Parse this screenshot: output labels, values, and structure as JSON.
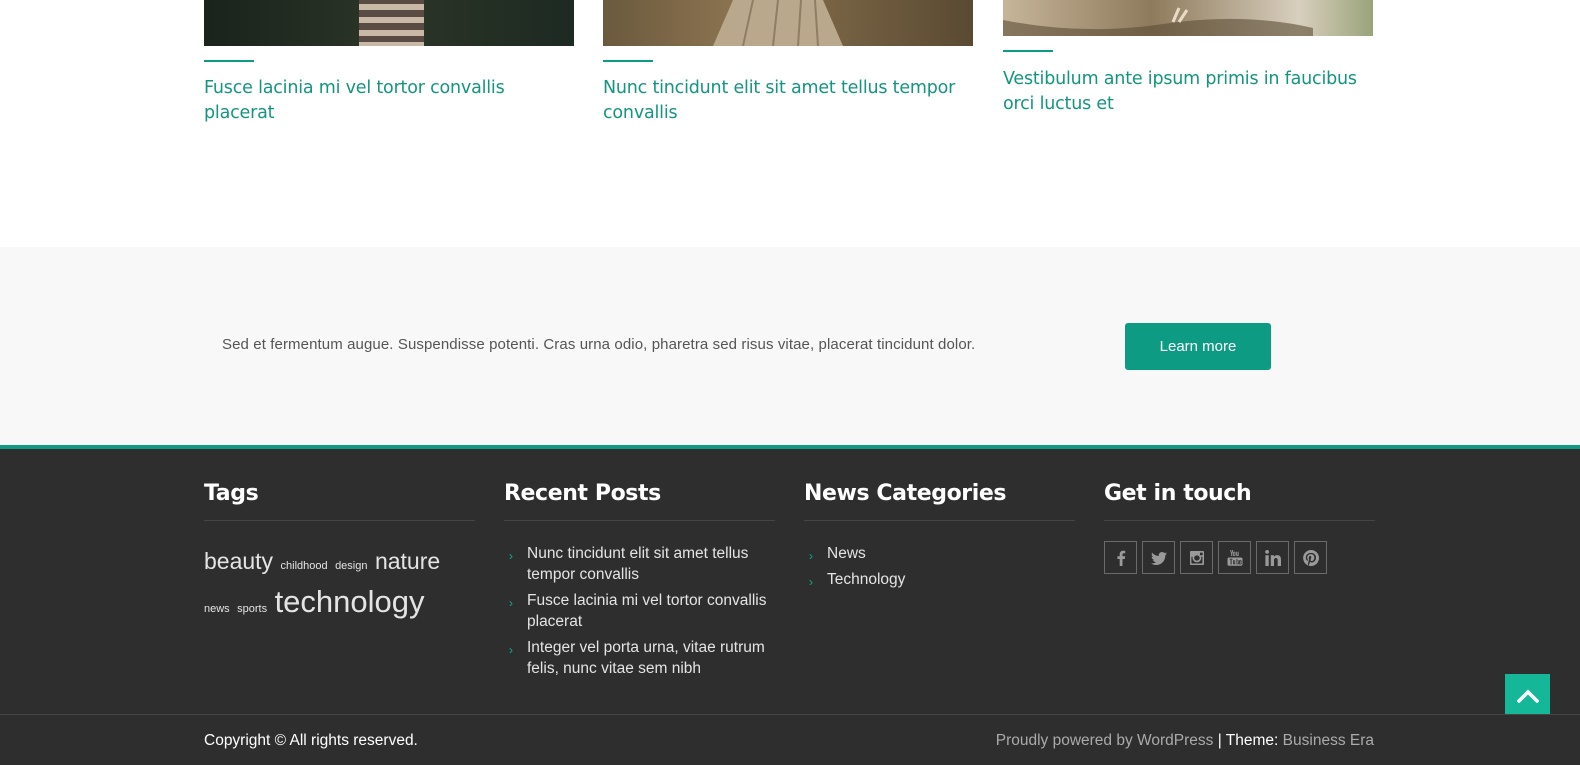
{
  "posts": [
    {
      "title": "Fusce lacinia mi vel tortor convallis placerat"
    },
    {
      "title": "Nunc tincidunt elit sit amet tellus tempor convallis"
    },
    {
      "title": "Vestibulum ante ipsum primis in faucibus orci luctus et"
    }
  ],
  "cta": {
    "text": "Sed et fermentum augue. Suspendisse potenti. Cras urna odio, pharetra sed risus vitae, placerat tincidunt dolor.",
    "button": "Learn more"
  },
  "footer": {
    "tags": {
      "title": "Tags",
      "items": [
        "beauty",
        "childhood",
        "design",
        "nature",
        "news",
        "sports",
        "technology"
      ]
    },
    "recent_posts": {
      "title": "Recent Posts",
      "items": [
        "Nunc tincidunt elit sit amet tellus tempor convallis",
        "Fusce lacinia mi vel tortor convallis placerat",
        "Integer vel porta urna, vitae rutrum felis, nunc vitae sem nibh"
      ]
    },
    "categories": {
      "title": "News Categories",
      "items": [
        "News",
        "Technology"
      ]
    },
    "contact": {
      "title": "Get in touch",
      "socials": [
        "facebook-icon",
        "twitter-icon",
        "instagram-icon",
        "youtube-icon",
        "linkedin-icon",
        "pinterest-icon"
      ]
    }
  },
  "bottom": {
    "copyright": "Copyright © All rights reserved.",
    "powered": "Proudly powered by WordPress",
    "separator": "|",
    "theme_label": "Theme:",
    "theme_name": "Business Era"
  },
  "colors": {
    "accent": "#0e9b84",
    "footer_bg": "#2e2e2e",
    "cta_bg": "#f8f8f8",
    "to_top": "#14b899"
  }
}
